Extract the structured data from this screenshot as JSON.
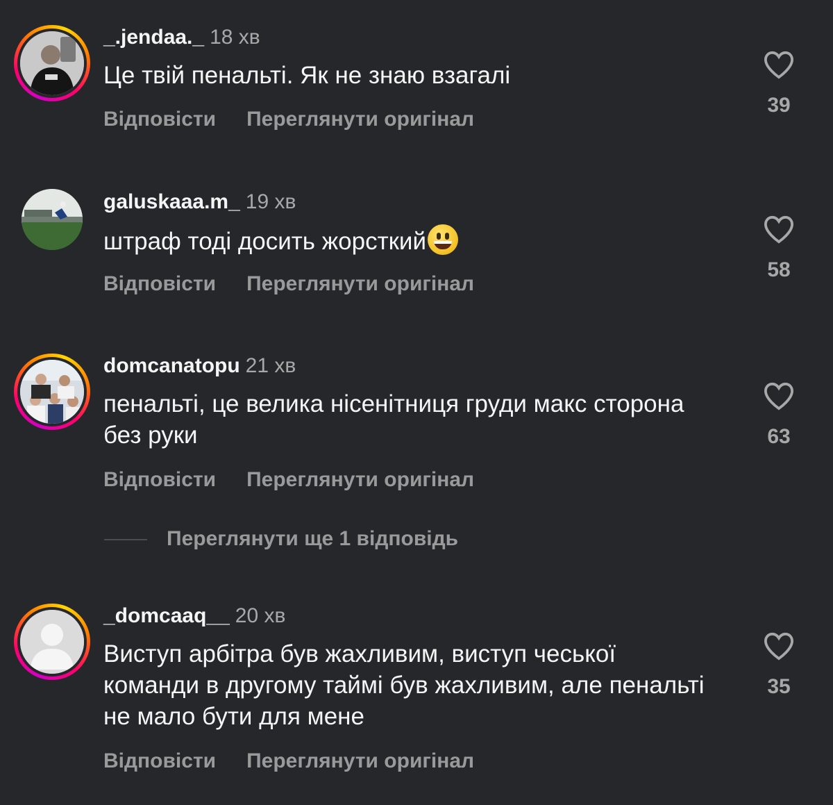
{
  "comments": [
    {
      "username": "_.jendaa._",
      "time": "18 хв",
      "text": "Це твій пенальті. Як не знаю взагалі",
      "reply": "Відповісти",
      "view_original": "Переглянути оригінал",
      "likes": "39",
      "has_story_ring": true
    },
    {
      "username": "galuskaaa.m_",
      "time": "19 хв",
      "text": "штраф тоді досить жорсткий",
      "emoji": "😃",
      "reply": "Відповісти",
      "view_original": "Переглянути оригінал",
      "likes": "58",
      "has_story_ring": false
    },
    {
      "username": "domcanatopu",
      "time": "21 хв",
      "text": "пенальті, це велика нісенітниця груди макс сторона без руки",
      "reply": "Відповісти",
      "view_original": "Переглянути оригінал",
      "likes": "63",
      "has_story_ring": true
    },
    {
      "username": "_domcaaq__",
      "time": "20 хв",
      "text": "Виступ арбітра був жахливим, виступ чеської команди в другому таймі був жахливим, але пенальті не мало бути для мене",
      "reply": "Відповісти",
      "view_original": "Переглянути оригінал",
      "likes": "35",
      "has_story_ring": true
    }
  ],
  "view_more_replies": "Переглянути ще 1 відповідь",
  "icons": {
    "like": "heart-outline-icon"
  },
  "colors": {
    "background": "#25272b",
    "secondary_text": "#a8a8a8"
  }
}
